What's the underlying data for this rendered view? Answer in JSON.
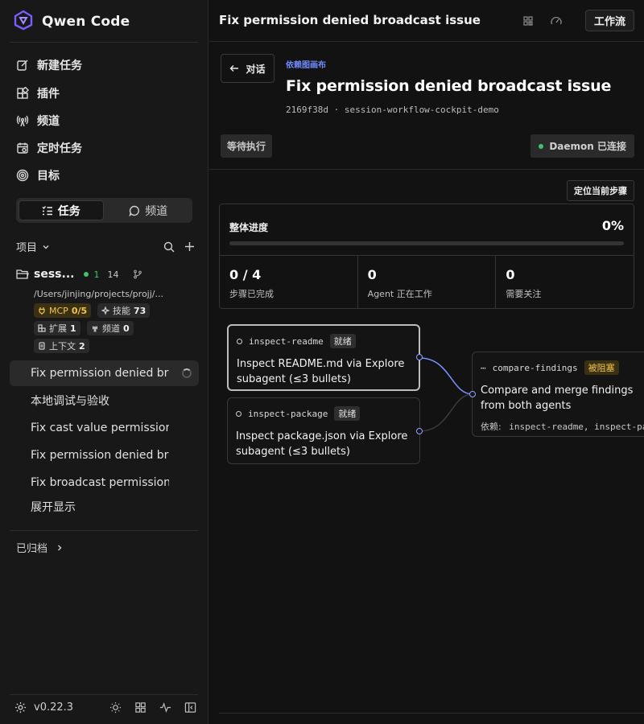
{
  "brand": {
    "name": "Qwen Code",
    "accent": "#7a5cff"
  },
  "nav": [
    {
      "label": "新建任务",
      "icon": "edit-icon"
    },
    {
      "label": "插件",
      "icon": "plugin-icon"
    },
    {
      "label": "频道",
      "icon": "broadcast-icon"
    },
    {
      "label": "定时任务",
      "icon": "calendar-icon"
    },
    {
      "label": "目标",
      "icon": "target-icon"
    }
  ],
  "segment": {
    "tasks": "任务",
    "channels": "频道"
  },
  "projects": {
    "header": "项目",
    "workspace": {
      "name": "sess...",
      "active_count": "1",
      "total_count": "14",
      "path": "/Users/jinjing/projects/projj/...",
      "chips": {
        "mcp_label": "MCP",
        "mcp_value": "0/5",
        "skills_label": "技能",
        "skills_value": "73",
        "ext_label": "扩展",
        "ext_value": "1",
        "channels_label": "频道",
        "channels_value": "0",
        "context_label": "上下文",
        "context_value": "2"
      }
    },
    "tasks": [
      "Fix permission denied broadcast issue",
      "本地调试与验收",
      "Fix cast value permission issue",
      "Fix permission denied broadcast issue",
      "Fix broadcast permission issue"
    ],
    "show_more": "展开显示"
  },
  "archived": "已归档",
  "version": "v0.22.3",
  "topbar": {
    "title": "Fix permission denied broadcast issue",
    "workflow": "工作流"
  },
  "header": {
    "back": "对话",
    "crumb": "依赖图画布",
    "title": "Fix permission denied broadcast issue",
    "meta": "2169f38d · session-workflow-cockpit-demo",
    "waiting": "等待执行",
    "daemon": "Daemon 已连接",
    "daemon_color": "#3ec46d"
  },
  "locate": "定位当前步骤",
  "progress": {
    "label": "整体进度",
    "percent_text": "0%",
    "fraction": 0,
    "stats": [
      {
        "value": "0 / 4",
        "caption": "步骤已完成"
      },
      {
        "value": "0",
        "caption": "Agent 正在工作"
      },
      {
        "value": "0",
        "caption": "需要关注"
      }
    ]
  },
  "nodes": [
    {
      "id": "inspect-readme",
      "status": "就绪",
      "text": "Inspect README.md via Explore subagent (≤3 bullets)"
    },
    {
      "id": "inspect-package",
      "status": "就绪",
      "text": "Inspect package.json via Explore subagent (≤3 bullets)"
    },
    {
      "id": "compare-findings",
      "status": "被阻塞",
      "text": "Compare and merge findings from both agents",
      "dep_label": "依赖:",
      "deps": "inspect-readme, inspect-package"
    }
  ]
}
